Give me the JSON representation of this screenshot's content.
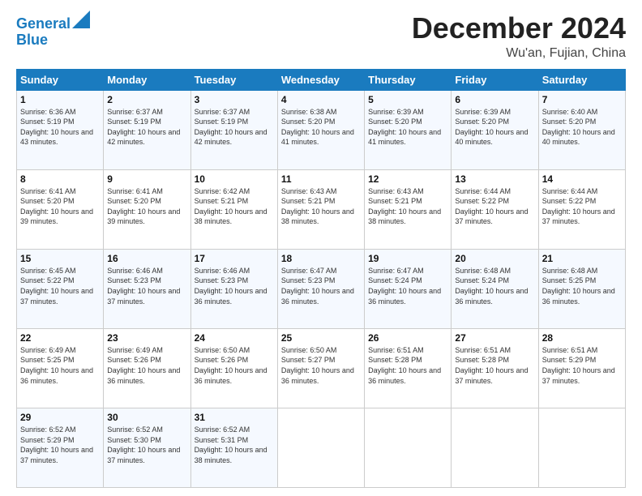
{
  "header": {
    "logo_line1": "General",
    "logo_line2": "Blue",
    "title": "December 2024",
    "location": "Wu'an, Fujian, China"
  },
  "days_of_week": [
    "Sunday",
    "Monday",
    "Tuesday",
    "Wednesday",
    "Thursday",
    "Friday",
    "Saturday"
  ],
  "weeks": [
    [
      {
        "day": "1",
        "sunrise": "6:36 AM",
        "sunset": "5:19 PM",
        "daylight": "10 hours and 43 minutes."
      },
      {
        "day": "2",
        "sunrise": "6:37 AM",
        "sunset": "5:19 PM",
        "daylight": "10 hours and 42 minutes."
      },
      {
        "day": "3",
        "sunrise": "6:37 AM",
        "sunset": "5:19 PM",
        "daylight": "10 hours and 42 minutes."
      },
      {
        "day": "4",
        "sunrise": "6:38 AM",
        "sunset": "5:20 PM",
        "daylight": "10 hours and 41 minutes."
      },
      {
        "day": "5",
        "sunrise": "6:39 AM",
        "sunset": "5:20 PM",
        "daylight": "10 hours and 41 minutes."
      },
      {
        "day": "6",
        "sunrise": "6:39 AM",
        "sunset": "5:20 PM",
        "daylight": "10 hours and 40 minutes."
      },
      {
        "day": "7",
        "sunrise": "6:40 AM",
        "sunset": "5:20 PM",
        "daylight": "10 hours and 40 minutes."
      }
    ],
    [
      {
        "day": "8",
        "sunrise": "6:41 AM",
        "sunset": "5:20 PM",
        "daylight": "10 hours and 39 minutes."
      },
      {
        "day": "9",
        "sunrise": "6:41 AM",
        "sunset": "5:20 PM",
        "daylight": "10 hours and 39 minutes."
      },
      {
        "day": "10",
        "sunrise": "6:42 AM",
        "sunset": "5:21 PM",
        "daylight": "10 hours and 38 minutes."
      },
      {
        "day": "11",
        "sunrise": "6:43 AM",
        "sunset": "5:21 PM",
        "daylight": "10 hours and 38 minutes."
      },
      {
        "day": "12",
        "sunrise": "6:43 AM",
        "sunset": "5:21 PM",
        "daylight": "10 hours and 38 minutes."
      },
      {
        "day": "13",
        "sunrise": "6:44 AM",
        "sunset": "5:22 PM",
        "daylight": "10 hours and 37 minutes."
      },
      {
        "day": "14",
        "sunrise": "6:44 AM",
        "sunset": "5:22 PM",
        "daylight": "10 hours and 37 minutes."
      }
    ],
    [
      {
        "day": "15",
        "sunrise": "6:45 AM",
        "sunset": "5:22 PM",
        "daylight": "10 hours and 37 minutes."
      },
      {
        "day": "16",
        "sunrise": "6:46 AM",
        "sunset": "5:23 PM",
        "daylight": "10 hours and 37 minutes."
      },
      {
        "day": "17",
        "sunrise": "6:46 AM",
        "sunset": "5:23 PM",
        "daylight": "10 hours and 36 minutes."
      },
      {
        "day": "18",
        "sunrise": "6:47 AM",
        "sunset": "5:23 PM",
        "daylight": "10 hours and 36 minutes."
      },
      {
        "day": "19",
        "sunrise": "6:47 AM",
        "sunset": "5:24 PM",
        "daylight": "10 hours and 36 minutes."
      },
      {
        "day": "20",
        "sunrise": "6:48 AM",
        "sunset": "5:24 PM",
        "daylight": "10 hours and 36 minutes."
      },
      {
        "day": "21",
        "sunrise": "6:48 AM",
        "sunset": "5:25 PM",
        "daylight": "10 hours and 36 minutes."
      }
    ],
    [
      {
        "day": "22",
        "sunrise": "6:49 AM",
        "sunset": "5:25 PM",
        "daylight": "10 hours and 36 minutes."
      },
      {
        "day": "23",
        "sunrise": "6:49 AM",
        "sunset": "5:26 PM",
        "daylight": "10 hours and 36 minutes."
      },
      {
        "day": "24",
        "sunrise": "6:50 AM",
        "sunset": "5:26 PM",
        "daylight": "10 hours and 36 minutes."
      },
      {
        "day": "25",
        "sunrise": "6:50 AM",
        "sunset": "5:27 PM",
        "daylight": "10 hours and 36 minutes."
      },
      {
        "day": "26",
        "sunrise": "6:51 AM",
        "sunset": "5:28 PM",
        "daylight": "10 hours and 36 minutes."
      },
      {
        "day": "27",
        "sunrise": "6:51 AM",
        "sunset": "5:28 PM",
        "daylight": "10 hours and 37 minutes."
      },
      {
        "day": "28",
        "sunrise": "6:51 AM",
        "sunset": "5:29 PM",
        "daylight": "10 hours and 37 minutes."
      }
    ],
    [
      {
        "day": "29",
        "sunrise": "6:52 AM",
        "sunset": "5:29 PM",
        "daylight": "10 hours and 37 minutes."
      },
      {
        "day": "30",
        "sunrise": "6:52 AM",
        "sunset": "5:30 PM",
        "daylight": "10 hours and 37 minutes."
      },
      {
        "day": "31",
        "sunrise": "6:52 AM",
        "sunset": "5:31 PM",
        "daylight": "10 hours and 38 minutes."
      },
      null,
      null,
      null,
      null
    ]
  ]
}
